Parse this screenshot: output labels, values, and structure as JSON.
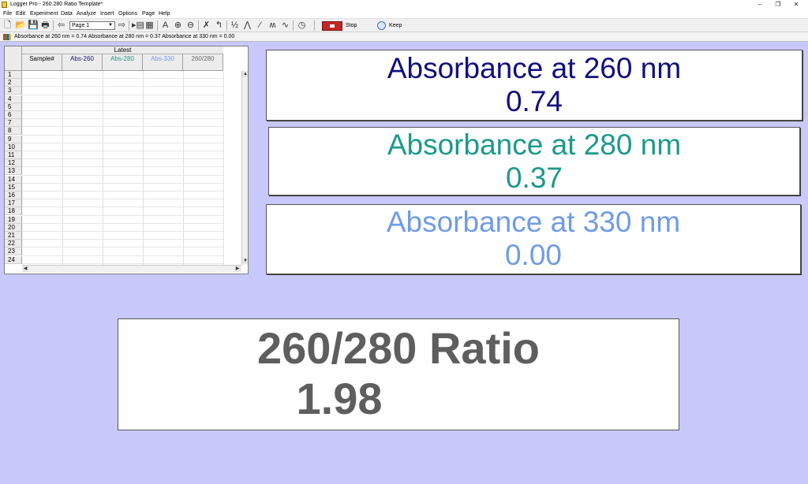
{
  "window": {
    "title": "Logger Pro - 260.280 Ratio Template*",
    "controls": {
      "minimize": "–",
      "restore": "❐",
      "close": "✕"
    }
  },
  "menu": [
    "File",
    "Edit",
    "Experiment",
    "Data",
    "Analyze",
    "Insert",
    "Options",
    "Page",
    "Help"
  ],
  "toolbar": {
    "page_select": "Page 1",
    "stop_label": "Stop",
    "keep_label": "Keep",
    "ratio_icon_label": "½"
  },
  "status": {
    "text": "Absorbance at 260 nm = 0.74  Absorbance at 280 nm = 0.37  Absorbance at 330 nm = 0.00"
  },
  "table": {
    "group_header": "Latest",
    "columns": [
      {
        "label": "Sample#",
        "color": "#000000"
      },
      {
        "label": "Abs-260",
        "color": "#10107e"
      },
      {
        "label": "Abs-280",
        "color": "#1b9a8c"
      },
      {
        "label": "Abs-330",
        "color": "#6f9ce6"
      },
      {
        "label": "260/280",
        "color": "#6a6a6a"
      }
    ],
    "rows": [
      "1",
      "2",
      "3",
      "4",
      "5",
      "6",
      "7",
      "8",
      "9",
      "10",
      "11",
      "12",
      "13",
      "14",
      "15",
      "16",
      "17",
      "18",
      "19",
      "20",
      "21",
      "22",
      "23",
      "24"
    ]
  },
  "meters": {
    "abs260": {
      "label": "Absorbance at 260 nm",
      "value": "0.74",
      "color": "#10107e"
    },
    "abs280": {
      "label": "Absorbance at 280 nm",
      "value": "0.37",
      "color": "#1b9a8c"
    },
    "abs330": {
      "label": "Absorbance at 330 nm",
      "value": "0.00",
      "color": "#6f9ce6"
    }
  },
  "ratio": {
    "label": "260/280 Ratio",
    "value": "1.98"
  },
  "colors": {
    "background": "#c8c8fa"
  }
}
